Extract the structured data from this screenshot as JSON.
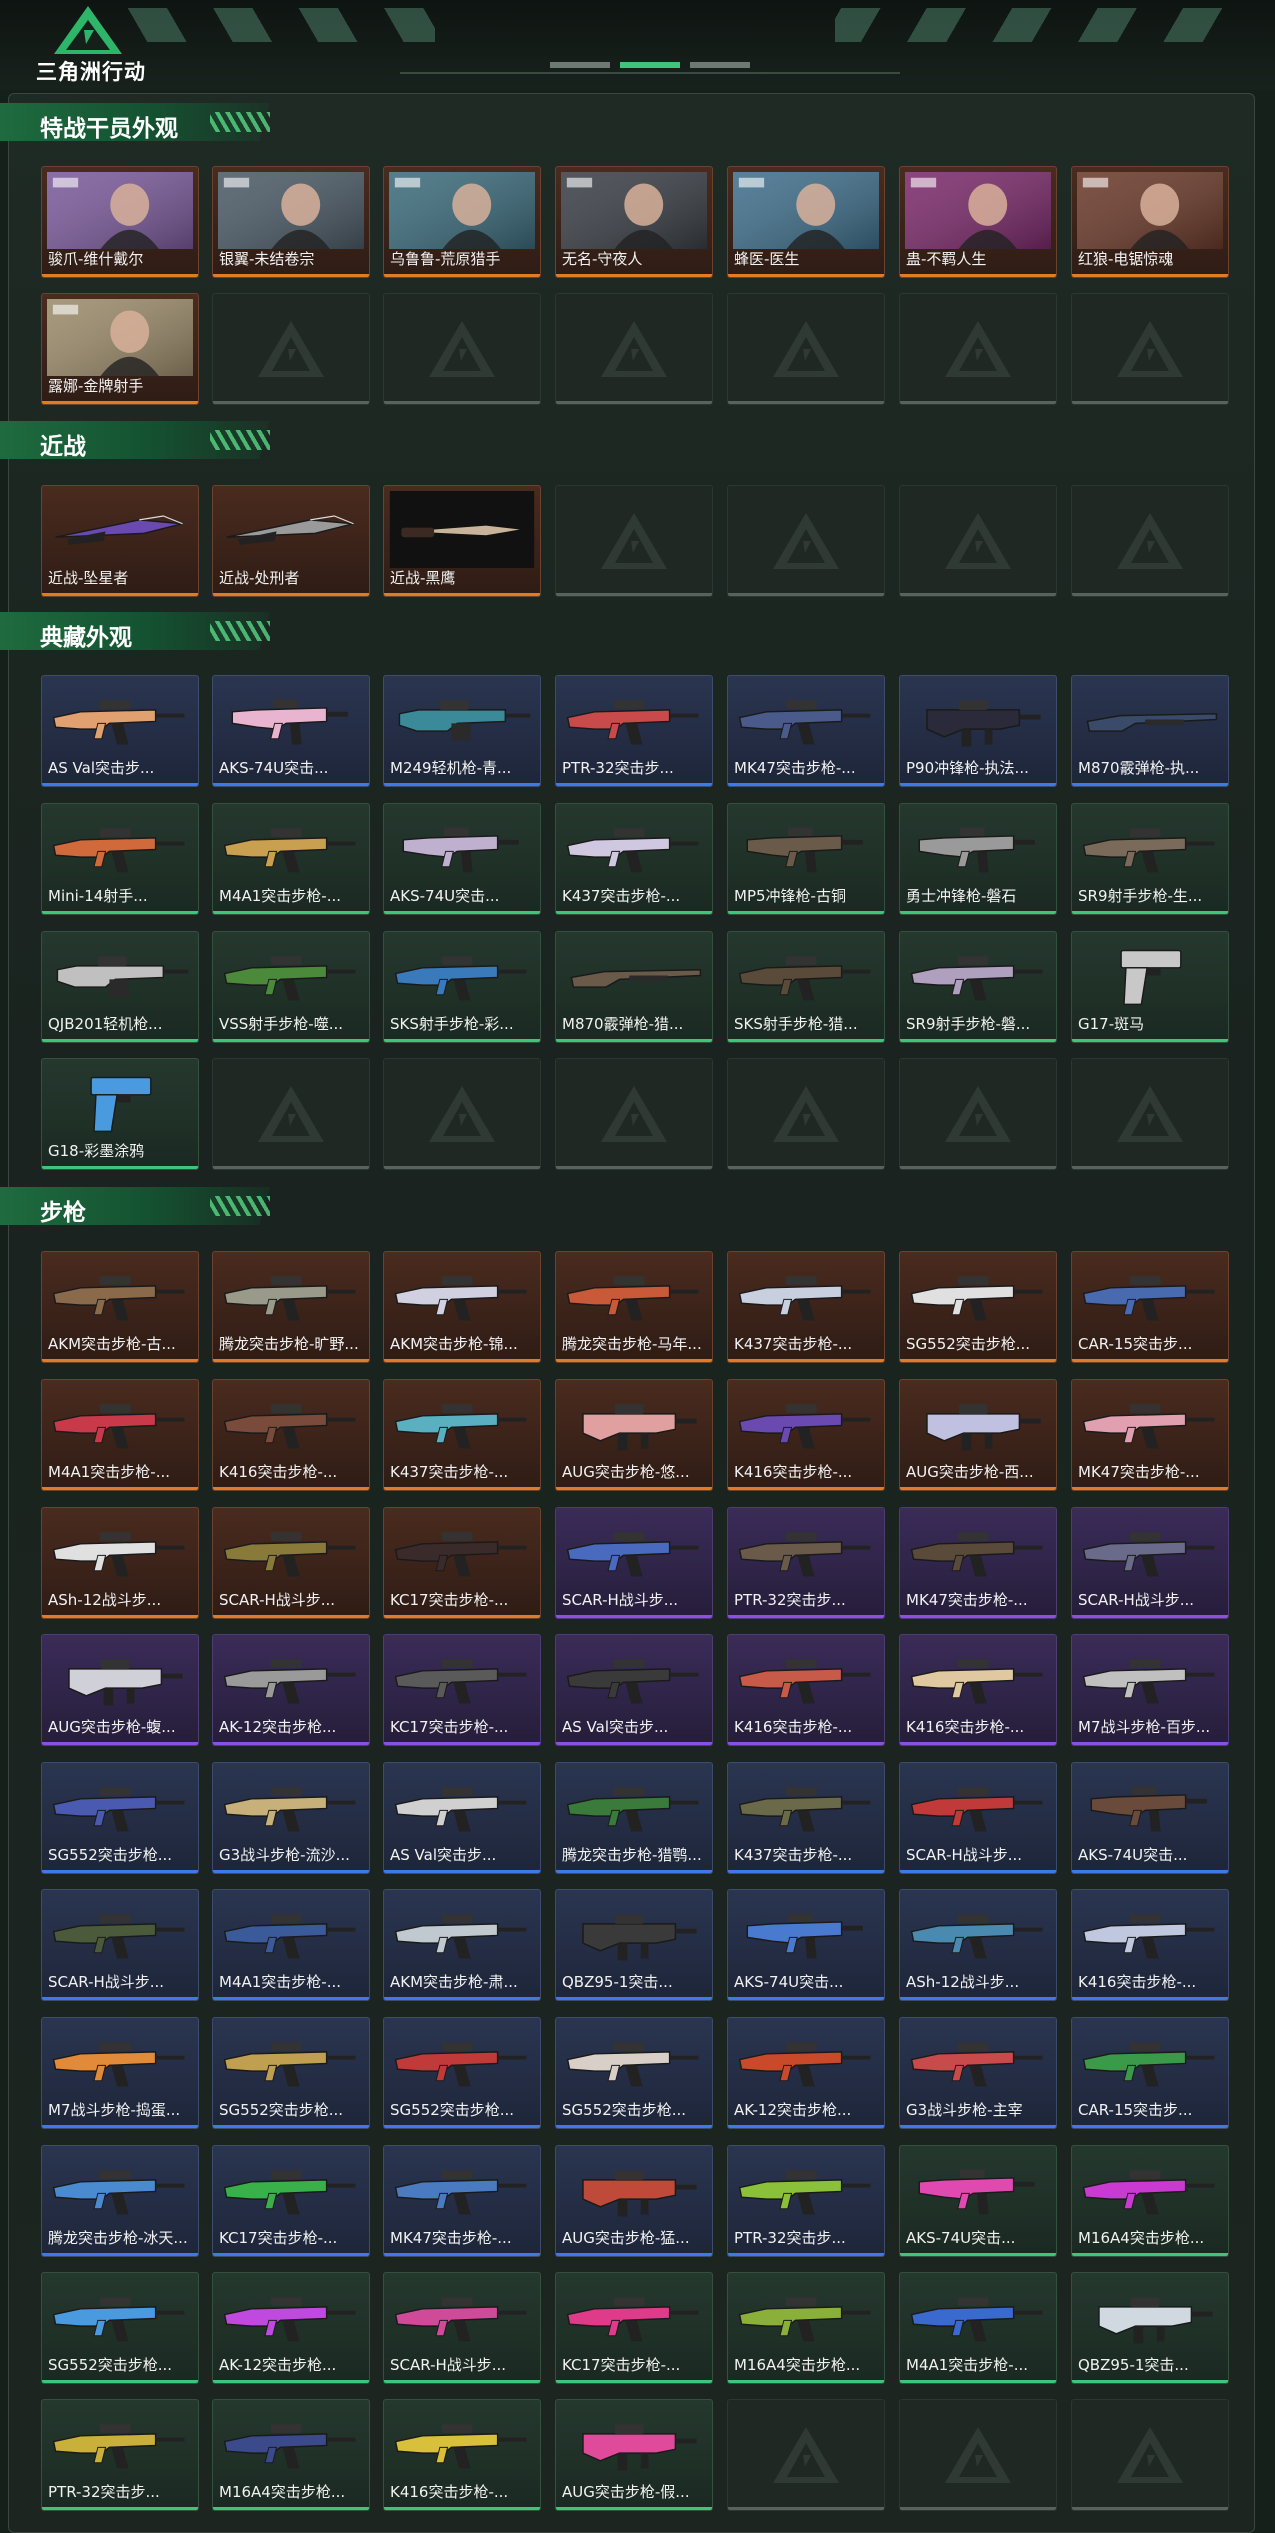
{
  "brand": {
    "name": "三角洲行动",
    "accent": "#3fc479"
  },
  "rarity_colors": {
    "orange": "#e07c27",
    "purple": "#8b4fe6",
    "blue": "#3d79e8",
    "green": "#3fc479",
    "empty": "#59635e"
  },
  "sections": [
    {
      "title": "特战干员外观",
      "items": [
        {
          "label": "骏爪-维什戴尔",
          "rarity": "orange",
          "kind": "portrait",
          "color": "#7a5a9a"
        },
        {
          "label": "银翼-未结卷宗",
          "rarity": "orange",
          "kind": "portrait",
          "color": "#4b5a66"
        },
        {
          "label": "乌鲁鲁-荒原猎手",
          "rarity": "orange",
          "kind": "portrait",
          "color": "#3b6a7a"
        },
        {
          "label": "无名-守夜人",
          "rarity": "orange",
          "kind": "portrait",
          "color": "#3a3f46"
        },
        {
          "label": "蜂医-医生",
          "rarity": "orange",
          "kind": "portrait",
          "color": "#3f6e8a"
        },
        {
          "label": "蛊-不羁人生",
          "rarity": "orange",
          "kind": "portrait",
          "color": "#7a2a6a"
        },
        {
          "label": "红狼-电锯惊魂",
          "rarity": "orange",
          "kind": "portrait",
          "color": "#6a3a2a"
        },
        {
          "label": "露娜-金牌射手",
          "rarity": "orange",
          "kind": "portrait",
          "color": "#9a8a6a"
        },
        {
          "label": "",
          "rarity": "empty"
        },
        {
          "label": "",
          "rarity": "empty"
        },
        {
          "label": "",
          "rarity": "empty"
        },
        {
          "label": "",
          "rarity": "empty"
        },
        {
          "label": "",
          "rarity": "empty"
        },
        {
          "label": "",
          "rarity": "empty"
        }
      ]
    },
    {
      "title": "近战",
      "items": [
        {
          "label": "近战-坠星者",
          "rarity": "orange",
          "kind": "blade",
          "color": "#6a4ab0"
        },
        {
          "label": "近战-处刑者",
          "rarity": "orange",
          "kind": "blade",
          "color": "#9a9a9a"
        },
        {
          "label": "近战-黑鹰",
          "rarity": "orange",
          "kind": "knife",
          "color": "#c8b49a"
        },
        {
          "label": "",
          "rarity": "empty"
        },
        {
          "label": "",
          "rarity": "empty"
        },
        {
          "label": "",
          "rarity": "empty"
        },
        {
          "label": "",
          "rarity": "empty"
        }
      ]
    },
    {
      "title": "典藏外观",
      "items": [
        {
          "label": "AS Val突击步...",
          "rarity": "blue",
          "kind": "rifle",
          "color": "#e0a070"
        },
        {
          "label": "AKS-74U突击...",
          "rarity": "blue",
          "kind": "smg",
          "color": "#e8b4d0"
        },
        {
          "label": "M249轻机枪-青...",
          "rarity": "blue",
          "kind": "lmg",
          "color": "#3a8a9a"
        },
        {
          "label": "PTR-32突击步...",
          "rarity": "blue",
          "kind": "rifle",
          "color": "#c84a4a"
        },
        {
          "label": "MK47突击步枪-...",
          "rarity": "blue",
          "kind": "rifle",
          "color": "#4a5a8a"
        },
        {
          "label": "P90冲锋枪-执法...",
          "rarity": "blue",
          "kind": "bullpup",
          "color": "#2a2a3a"
        },
        {
          "label": "M870霰弹枪-执...",
          "rarity": "blue",
          "kind": "shotgun",
          "color": "#3a4a6a"
        },
        {
          "label": "Mini-14射手...",
          "rarity": "green",
          "kind": "rifle",
          "color": "#d06a3a"
        },
        {
          "label": "M4A1突击步枪-...",
          "rarity": "green",
          "kind": "rifle",
          "color": "#c8a050"
        },
        {
          "label": "AKS-74U突击...",
          "rarity": "green",
          "kind": "smg",
          "color": "#c0b0d0"
        },
        {
          "label": "K437突击步枪-...",
          "rarity": "green",
          "kind": "rifle",
          "color": "#d0c8e0"
        },
        {
          "label": "MP5冲锋枪-古铜",
          "rarity": "green",
          "kind": "smg",
          "color": "#6a5a4a"
        },
        {
          "label": "勇士冲锋枪-磐石",
          "rarity": "green",
          "kind": "smg",
          "color": "#9a9a9a"
        },
        {
          "label": "SR9射手步枪-生...",
          "rarity": "green",
          "kind": "rifle",
          "color": "#7a6a5a"
        },
        {
          "label": "QJB201轻机枪...",
          "rarity": "green",
          "kind": "lmg",
          "color": "#c0c0c0"
        },
        {
          "label": "VSS射手步枪-噬...",
          "rarity": "green",
          "kind": "rifle",
          "color": "#4a8a3a"
        },
        {
          "label": "SKS射手步枪-彩...",
          "rarity": "green",
          "kind": "rifle",
          "color": "#3a7aba"
        },
        {
          "label": "M870霰弹枪-猎...",
          "rarity": "green",
          "kind": "shotgun",
          "color": "#6a5a4a"
        },
        {
          "label": "SKS射手步枪-猎...",
          "rarity": "green",
          "kind": "rifle",
          "color": "#5a4a3a"
        },
        {
          "label": "SR9射手步枪-磐...",
          "rarity": "green",
          "kind": "rifle",
          "color": "#b0a0c0"
        },
        {
          "label": "G17-斑马",
          "rarity": "green",
          "kind": "pistol",
          "color": "#c8c8c8"
        },
        {
          "label": "G18-彩墨涂鸦",
          "rarity": "green",
          "kind": "pistol",
          "color": "#4a9ae0"
        },
        {
          "label": "",
          "rarity": "empty"
        },
        {
          "label": "",
          "rarity": "empty"
        },
        {
          "label": "",
          "rarity": "empty"
        },
        {
          "label": "",
          "rarity": "empty"
        },
        {
          "label": "",
          "rarity": "empty"
        },
        {
          "label": "",
          "rarity": "empty"
        }
      ]
    },
    {
      "title": "步枪",
      "items": [
        {
          "label": "AKM突击步枪-古...",
          "rarity": "orange",
          "kind": "rifle",
          "color": "#8a6a4a"
        },
        {
          "label": "腾龙突击步枪-旷野...",
          "rarity": "orange",
          "kind": "rifle",
          "color": "#9a9a8a"
        },
        {
          "label": "AKM突击步枪-锦...",
          "rarity": "orange",
          "kind": "rifle",
          "color": "#d0d0e0"
        },
        {
          "label": "腾龙突击步枪-马年...",
          "rarity": "orange",
          "kind": "rifle",
          "color": "#c85a3a"
        },
        {
          "label": "K437突击步枪-...",
          "rarity": "orange",
          "kind": "rifle",
          "color": "#c8d0e0"
        },
        {
          "label": "SG552突击步枪...",
          "rarity": "orange",
          "kind": "rifle",
          "color": "#e0e0e0"
        },
        {
          "label": "CAR-15突击步...",
          "rarity": "orange",
          "kind": "rifle",
          "color": "#4a6ab0"
        },
        {
          "label": "M4A1突击步枪-...",
          "rarity": "orange",
          "kind": "rifle",
          "color": "#c83a4a"
        },
        {
          "label": "K416突击步枪-...",
          "rarity": "orange",
          "kind": "rifle",
          "color": "#7a4a3a"
        },
        {
          "label": "K437突击步枪-...",
          "rarity": "orange",
          "kind": "rifle",
          "color": "#5ab0c0"
        },
        {
          "label": "AUG突击步枪-悠...",
          "rarity": "orange",
          "kind": "bullpup",
          "color": "#e0a0a0"
        },
        {
          "label": "K416突击步枪-...",
          "rarity": "orange",
          "kind": "rifle",
          "color": "#6a4ab0"
        },
        {
          "label": "AUG突击步枪-西...",
          "rarity": "orange",
          "kind": "bullpup",
          "color": "#c0c0e0"
        },
        {
          "label": "MK47突击步枪-...",
          "rarity": "orange",
          "kind": "rifle",
          "color": "#e0a0b0"
        },
        {
          "label": "ASh-12战斗步...",
          "rarity": "orange",
          "kind": "rifle",
          "color": "#e0e0e0"
        },
        {
          "label": "SCAR-H战斗步...",
          "rarity": "orange",
          "kind": "rifle",
          "color": "#8a7a3a"
        },
        {
          "label": "KC17突击步枪-...",
          "rarity": "orange",
          "kind": "rifle",
          "color": "#3a2a2a"
        },
        {
          "label": "SCAR-H战斗步...",
          "rarity": "purple",
          "kind": "rifle",
          "color": "#4a6ac0"
        },
        {
          "label": "PTR-32突击步...",
          "rarity": "purple",
          "kind": "rifle",
          "color": "#6a5a4a"
        },
        {
          "label": "MK47突击步枪-...",
          "rarity": "purple",
          "kind": "rifle",
          "color": "#5a4a3a"
        },
        {
          "label": "SCAR-H战斗步...",
          "rarity": "purple",
          "kind": "rifle",
          "color": "#6a6a8a"
        },
        {
          "label": "AUG突击步枪-蝮...",
          "rarity": "purple",
          "kind": "bullpup",
          "color": "#d0d0d8"
        },
        {
          "label": "AK-12突击步枪...",
          "rarity": "purple",
          "kind": "rifle",
          "color": "#9a9a9a"
        },
        {
          "label": "KC17突击步枪-...",
          "rarity": "purple",
          "kind": "rifle",
          "color": "#5a5a5a"
        },
        {
          "label": "AS Val突击步...",
          "rarity": "purple",
          "kind": "rifle",
          "color": "#3a3a3a"
        },
        {
          "label": "K416突击步枪-...",
          "rarity": "purple",
          "kind": "rifle",
          "color": "#c85a4a"
        },
        {
          "label": "K416突击步枪-...",
          "rarity": "purple",
          "kind": "rifle",
          "color": "#e0c8a0"
        },
        {
          "label": "M7战斗步枪-百步...",
          "rarity": "purple",
          "kind": "rifle",
          "color": "#c0c0c0"
        },
        {
          "label": "SG552突击步枪...",
          "rarity": "blue",
          "kind": "rifle",
          "color": "#4a5ab0"
        },
        {
          "label": "G3战斗步枪-流沙...",
          "rarity": "blue",
          "kind": "rifle",
          "color": "#c8b07a"
        },
        {
          "label": "AS Val突击步...",
          "rarity": "blue",
          "kind": "rifle",
          "color": "#d0d0d0"
        },
        {
          "label": "腾龙突击步枪-猎鹗...",
          "rarity": "blue",
          "kind": "rifle",
          "color": "#3a7a3a"
        },
        {
          "label": "K437突击步枪-...",
          "rarity": "blue",
          "kind": "rifle",
          "color": "#6a6a4a"
        },
        {
          "label": "SCAR-H战斗步...",
          "rarity": "blue",
          "kind": "rifle",
          "color": "#c03a3a"
        },
        {
          "label": "AKS-74U突击...",
          "rarity": "blue",
          "kind": "smg",
          "color": "#6a4a3a"
        },
        {
          "label": "SCAR-H战斗步...",
          "rarity": "blue",
          "kind": "rifle",
          "color": "#4a5a3a"
        },
        {
          "label": "M4A1突击步枪-...",
          "rarity": "blue",
          "kind": "rifle",
          "color": "#3a5a9a"
        },
        {
          "label": "AKM突击步枪-肃...",
          "rarity": "blue",
          "kind": "rifle",
          "color": "#c0c8d0"
        },
        {
          "label": "QBZ95-1突击...",
          "rarity": "blue",
          "kind": "bullpup",
          "color": "#3a3a3a"
        },
        {
          "label": "AKS-74U突击...",
          "rarity": "blue",
          "kind": "smg",
          "color": "#4a7ad0"
        },
        {
          "label": "ASh-12战斗步...",
          "rarity": "blue",
          "kind": "rifle",
          "color": "#4a8ab0"
        },
        {
          "label": "K416突击步枪-...",
          "rarity": "blue",
          "kind": "rifle",
          "color": "#c0c8e0"
        },
        {
          "label": "M7战斗步枪-捣蛋...",
          "rarity": "blue",
          "kind": "rifle",
          "color": "#e08a3a"
        },
        {
          "label": "SG552突击步枪...",
          "rarity": "blue",
          "kind": "rifle",
          "color": "#c0a050"
        },
        {
          "label": "SG552突击步枪...",
          "rarity": "blue",
          "kind": "rifle",
          "color": "#c03a3a"
        },
        {
          "label": "SG552突击步枪...",
          "rarity": "blue",
          "kind": "rifle",
          "color": "#d8d0c8"
        },
        {
          "label": "AK-12突击步枪...",
          "rarity": "blue",
          "kind": "rifle",
          "color": "#c84a2a"
        },
        {
          "label": "G3战斗步枪-主宰",
          "rarity": "blue",
          "kind": "rifle",
          "color": "#c84a4a"
        },
        {
          "label": "CAR-15突击步...",
          "rarity": "blue",
          "kind": "rifle",
          "color": "#3a9a4a"
        },
        {
          "label": "腾龙突击步枪-冰天...",
          "rarity": "blue",
          "kind": "rifle",
          "color": "#4a8ad0"
        },
        {
          "label": "KC17突击步枪-...",
          "rarity": "blue",
          "kind": "rifle",
          "color": "#3ab04a"
        },
        {
          "label": "MK47突击步枪-...",
          "rarity": "blue",
          "kind": "rifle",
          "color": "#4a7ac0"
        },
        {
          "label": "AUG突击步枪-猛...",
          "rarity": "blue",
          "kind": "bullpup",
          "color": "#c04a3a"
        },
        {
          "label": "PTR-32突击步...",
          "rarity": "blue",
          "kind": "rifle",
          "color": "#8ac03a"
        },
        {
          "label": "AKS-74U突击...",
          "rarity": "green",
          "kind": "smg",
          "color": "#e04ab0"
        },
        {
          "label": "M16A4突击步枪...",
          "rarity": "green",
          "kind": "rifle",
          "color": "#c83ad0"
        },
        {
          "label": "SG552突击步枪...",
          "rarity": "green",
          "kind": "rifle",
          "color": "#4a9ae0"
        },
        {
          "label": "AK-12突击步枪...",
          "rarity": "green",
          "kind": "rifle",
          "color": "#c04ae0"
        },
        {
          "label": "SCAR-H战斗步...",
          "rarity": "green",
          "kind": "rifle",
          "color": "#d04a9a"
        },
        {
          "label": "KC17突击步枪-...",
          "rarity": "green",
          "kind": "rifle",
          "color": "#e03a8a"
        },
        {
          "label": "M16A4突击步枪...",
          "rarity": "green",
          "kind": "rifle",
          "color": "#8ab03a"
        },
        {
          "label": "M4A1突击步枪-...",
          "rarity": "green",
          "kind": "rifle",
          "color": "#3a6ad0"
        },
        {
          "label": "QBZ95-1突击...",
          "rarity": "green",
          "kind": "bullpup",
          "color": "#d0d8e0"
        },
        {
          "label": "PTR-32突击步...",
          "rarity": "green",
          "kind": "rifle",
          "color": "#c8b03a"
        },
        {
          "label": "M16A4突击步枪...",
          "rarity": "green",
          "kind": "rifle",
          "color": "#3a4a8a"
        },
        {
          "label": "K416突击步枪-...",
          "rarity": "green",
          "kind": "rifle",
          "color": "#d8c03a"
        },
        {
          "label": "AUG突击步枪-假...",
          "rarity": "green",
          "kind": "bullpup",
          "color": "#e04a9a"
        },
        {
          "label": "",
          "rarity": "empty"
        },
        {
          "label": "",
          "rarity": "empty"
        },
        {
          "label": "",
          "rarity": "empty"
        }
      ]
    }
  ]
}
